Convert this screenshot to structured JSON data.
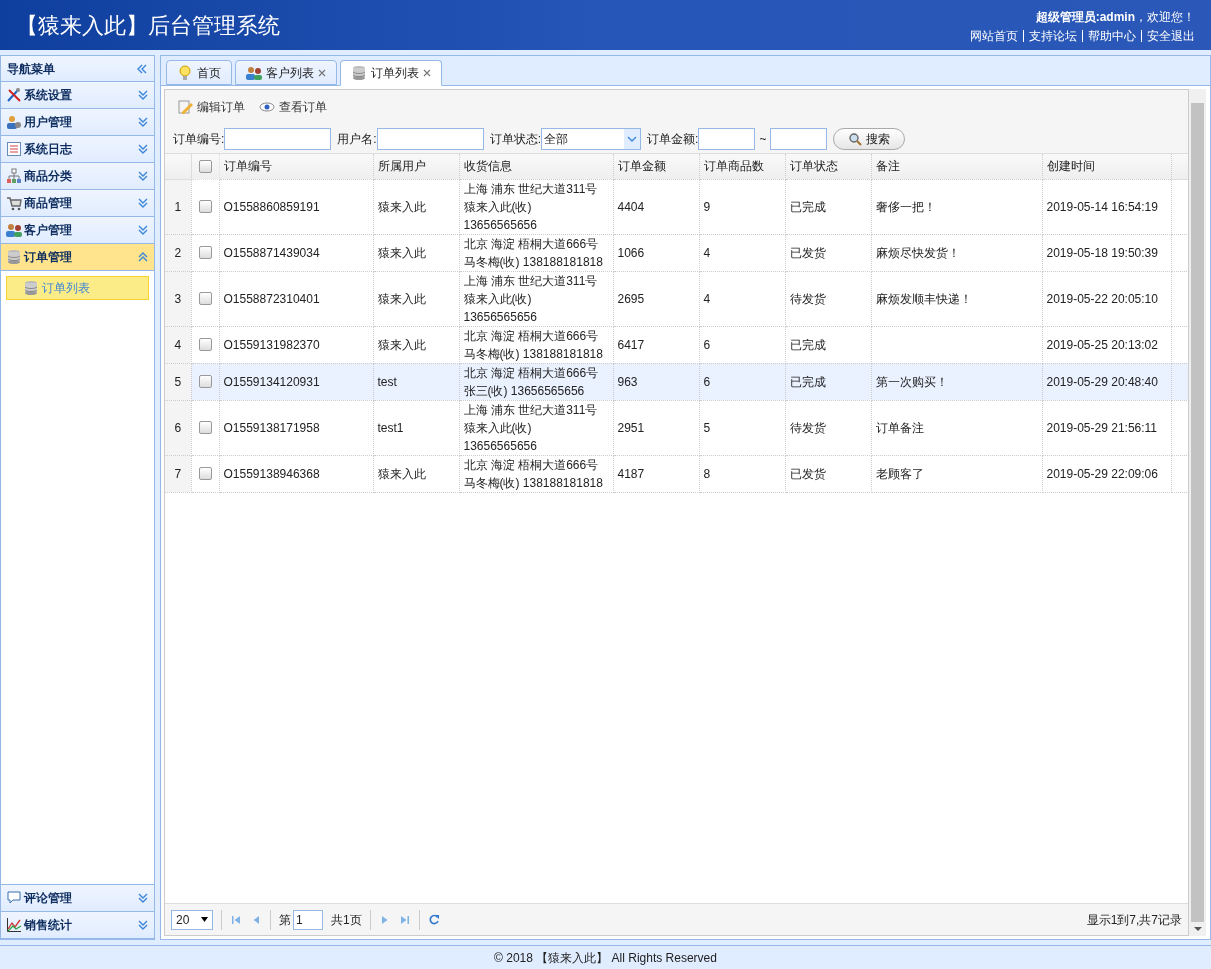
{
  "header": {
    "title": "【猿来入此】后台管理系统",
    "welcome": "**超级管理员:admin**，欢迎您！",
    "links": [
      "网站首页",
      "支持论坛",
      "帮助中心",
      "安全退出"
    ]
  },
  "sidebar": {
    "title": "导航菜单",
    "items": [
      {
        "label": "系统设置",
        "expanded": false
      },
      {
        "label": "用户管理",
        "expanded": false
      },
      {
        "label": "系统日志",
        "expanded": false
      },
      {
        "label": "商品分类",
        "expanded": false
      },
      {
        "label": "商品管理",
        "expanded": false
      },
      {
        "label": "客户管理",
        "expanded": false
      },
      {
        "label": "订单管理",
        "expanded": true,
        "children": [
          {
            "label": "订单列表",
            "selected": true
          }
        ]
      },
      {
        "label": "评论管理",
        "expanded": false
      },
      {
        "label": "销售统计",
        "expanded": false
      }
    ]
  },
  "tabs": [
    {
      "label": "首页",
      "closable": false,
      "selected": false
    },
    {
      "label": "客户列表",
      "closable": true,
      "selected": false
    },
    {
      "label": "订单列表",
      "closable": true,
      "selected": true
    }
  ],
  "toolbar": [
    "编辑订单",
    "查看订单"
  ],
  "filters": {
    "order_no_label": "订单编号:",
    "username_label": "用户名:",
    "status_label": "订单状态:",
    "status_value": "全部",
    "amount_label": "订单金额:",
    "range_sep": "~",
    "search_button": "搜索"
  },
  "table": {
    "all_checked": false,
    "columns": [
      "订单编号",
      "所属用户",
      "收货信息",
      "订单金额",
      "订单商品数",
      "订单状态",
      "备注",
      "创建时间"
    ],
    "rows": [
      {
        "index": "1",
        "checked": false,
        "selected": false,
        "cells": [
          "O1558860859191",
          "猿来入此",
          [
            "上海 浦东 世纪大道311号",
            "猿来入此(收)",
            "13656565656"
          ],
          "4404",
          "9",
          "已完成",
          "奢侈一把！",
          "2019-05-14 16:54:19"
        ]
      },
      {
        "index": "2",
        "checked": false,
        "selected": false,
        "cells": [
          "O1558871439034",
          "猿来入此",
          [
            "北京 海淀 梧桐大道666号",
            "马冬梅(收) 138188181818"
          ],
          "1066",
          "4",
          "已发货",
          "麻烦尽快发货！",
          "2019-05-18 19:50:39"
        ]
      },
      {
        "index": "3",
        "checked": false,
        "selected": false,
        "cells": [
          "O1558872310401",
          "猿来入此",
          [
            "上海 浦东 世纪大道311号",
            "猿来入此(收)",
            "13656565656"
          ],
          "2695",
          "4",
          "待发货",
          "麻烦发顺丰快递！",
          "2019-05-22 20:05:10"
        ]
      },
      {
        "index": "4",
        "checked": false,
        "selected": false,
        "cells": [
          "O1559131982370",
          "猿来入此",
          [
            "北京 海淀 梧桐大道666号",
            "马冬梅(收) 138188181818"
          ],
          "6417",
          "6",
          "已完成",
          null,
          "2019-05-25 20:13:02"
        ]
      },
      {
        "index": "5",
        "checked": false,
        "selected": true,
        "cells": [
          "O1559134120931",
          "test",
          [
            "北京 海淀 梧桐大道666号",
            "张三(收) 13656565656"
          ],
          "963",
          "6",
          "已完成",
          "第一次购买！",
          "2019-05-29 20:48:40"
        ]
      },
      {
        "index": "6",
        "checked": false,
        "selected": false,
        "cells": [
          "O1559138171958",
          "test1",
          [
            "上海 浦东 世纪大道311号",
            "猿来入此(收)",
            "13656565656"
          ],
          "2951",
          "5",
          "待发货",
          "订单备注",
          "2019-05-29 21:56:11"
        ]
      },
      {
        "index": "7",
        "checked": false,
        "selected": false,
        "cells": [
          "O1559138946368",
          "猿来入此",
          [
            "北京 海淀 梧桐大道666号",
            "马冬梅(收) 138188181818"
          ],
          "4187",
          "8",
          "已发货",
          "老顾客了",
          "2019-05-29 22:09:06"
        ]
      }
    ]
  },
  "pager": {
    "page_size": "20",
    "page_prefix": "第",
    "page": "1",
    "page_total": "共1页",
    "summary": "显示1到7,共7记录"
  },
  "footer": "© 2018 【猿来入此】 All Rights Reserved"
}
